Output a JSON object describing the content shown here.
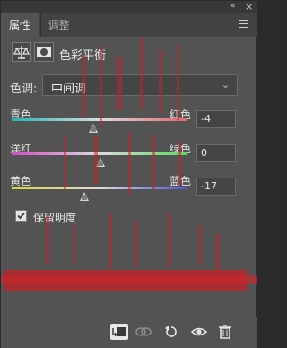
{
  "window": {
    "collapse_icon": "double-chevron-icon",
    "close_icon": "close-icon"
  },
  "tabs": [
    {
      "label": "属性",
      "active": true
    },
    {
      "label": "调整",
      "active": false
    }
  ],
  "header": {
    "title": "色彩平衡",
    "icons": [
      "balance-scale-icon",
      "layer-mask-icon"
    ]
  },
  "tone": {
    "label": "色调:",
    "selected": "中间调"
  },
  "sliders": [
    {
      "left": "青色",
      "right": "红色",
      "value": "-4",
      "left_color": "#21b7b7",
      "right_color": "#e2686e"
    },
    {
      "left": "洋红",
      "right": "绿色",
      "value": "0",
      "left_color": "#d449c8",
      "right_color": "#5bd95b"
    },
    {
      "left": "黄色",
      "right": "蓝色",
      "value": "-17",
      "left_color": "#d8d53c",
      "right_color": "#5050da"
    }
  ],
  "preserve": {
    "label": "保留明度",
    "checked": true
  },
  "toolbar": {
    "buttons": [
      "clip-to-layer-icon",
      "view-previous-icon",
      "reset-icon",
      "visibility-eye-icon",
      "trash-icon"
    ]
  },
  "colors": {
    "panel_bg": "#535353",
    "accent_red": "#c0262d"
  }
}
